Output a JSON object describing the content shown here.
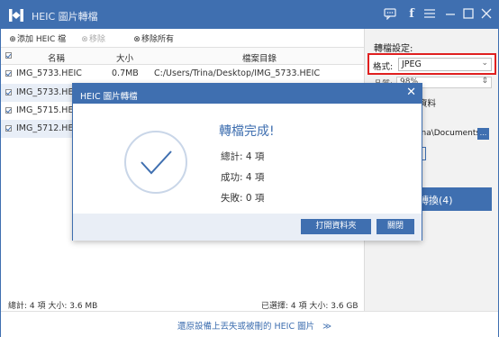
{
  "app": {
    "title": "HEIC 圖片轉檔"
  },
  "titlebar": {
    "icons": [
      "chat-icon",
      "facebook-icon",
      "menu-icon",
      "minimize-icon",
      "maximize-icon",
      "close-icon"
    ]
  },
  "toolbar": {
    "add_label": "添加 HEIC 檔",
    "remove_label": "移除",
    "remove_all_label": "移除所有"
  },
  "table": {
    "headers": {
      "name": "名稱",
      "size": "大小",
      "path": "檔案目錄"
    },
    "rows": [
      {
        "name": "IMG_5733.HEIC",
        "size": "0.7MB",
        "path": "C:/Users/Trina/Desktop/IMG_5733.HEIC"
      },
      {
        "name": "IMG_5733.HEIC",
        "size": "",
        "path": ""
      },
      {
        "name": "IMG_5715.HEIC",
        "size": "",
        "path": ""
      },
      {
        "name": "IMG_5712.HEIC",
        "size": "",
        "path": ""
      }
    ]
  },
  "right_panel": {
    "settings_label": "轉檔設定:",
    "format_label": "格式:",
    "format_value": "JPEG",
    "quality_label": "品質:",
    "quality_value": "98%",
    "keep_data_label": "資料",
    "output_path": "ina\\Documents\\",
    "browse_label": "...",
    "convert_label": "轉換(4)",
    "highlight_color": "#e02020"
  },
  "status": {
    "left": "總計: 4 項 大小: 3.6 MB",
    "right": "已選擇: 4 項 大小: 3.6 GB"
  },
  "footer": {
    "link_text": "還原設備上丟失或被刪的 HEIC 圖片",
    "link_arrow": "≫"
  },
  "modal": {
    "title": "HEIC 圖片轉檔",
    "heading": "轉檔完成!",
    "total": "總計: 4 項",
    "success": "成功: 4 項",
    "failed": "失敗: 0 項",
    "open_folder_label": "打開資料夾",
    "close_label": "關閉"
  },
  "colors": {
    "accent": "#3f6fb0",
    "selected_row": "#e8eef7"
  }
}
